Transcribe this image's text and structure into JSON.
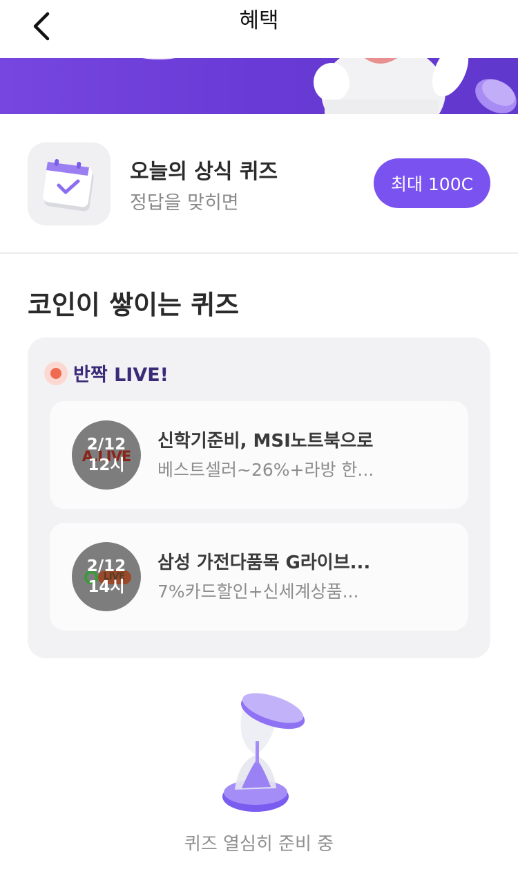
{
  "header": {
    "title": "혜택",
    "back_icon": "chevron-left-icon"
  },
  "daily_quiz": {
    "icon": "calendar-check-icon",
    "title": "오늘의 상식 퀴즈",
    "subtitle": "정답을 맞히면",
    "reward_label": "최대 100C"
  },
  "coin_quiz": {
    "section_title": "코인이 쌓이는 퀴즈",
    "live_label": "반짝 LIVE!",
    "items": [
      {
        "logo_text": "A.LIVE",
        "date": "2/12",
        "time": "12시",
        "title": "신학기준비, MSI노트북으로",
        "subtitle": "베스트셀러~26%+라방 한..."
      },
      {
        "logo_text": "LIVE",
        "date": "2/12",
        "time": "14시",
        "title": "삼성 가전다품목 G라이브...",
        "subtitle": "7%카드할인+신세계상품..."
      }
    ]
  },
  "footer": {
    "icon": "hourglass-icon",
    "text": "퀴즈 열심히 준비 중"
  },
  "colors": {
    "accent": "#7a52f0",
    "banner": "#6a3ad6",
    "live_dot": "#ef6a4f",
    "live_text": "#3b2a78"
  }
}
